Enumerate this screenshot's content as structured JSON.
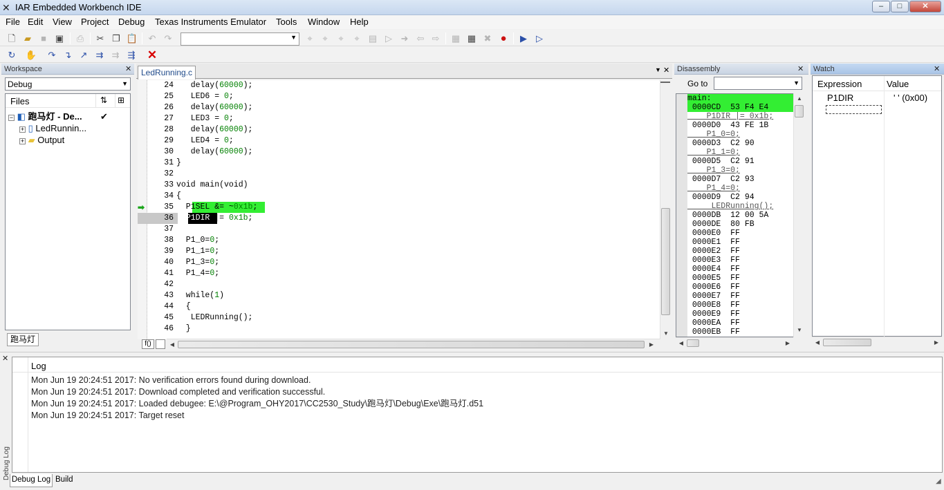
{
  "window": {
    "title": "IAR Embedded Workbench IDE",
    "minimize": "–",
    "maximize": "□",
    "close": "✕"
  },
  "menu": [
    "File",
    "Edit",
    "View",
    "Project",
    "Debug",
    "Texas Instruments Emulator",
    "Tools",
    "Window",
    "Help"
  ],
  "workspace": {
    "header": "Workspace",
    "config": "Debug",
    "files_label": "Files",
    "project": "跑马灯 - De...",
    "file1": "LedRunnin...",
    "folder": "Output",
    "bottom_tab": "跑马灯"
  },
  "editor": {
    "tab": "LedRunning.c",
    "lines": [
      {
        "n": "24",
        "t": "   delay(60000);"
      },
      {
        "n": "25",
        "t": "   LED6 = 0;"
      },
      {
        "n": "26",
        "t": "   delay(60000);"
      },
      {
        "n": "27",
        "t": "   LED3 = 0;"
      },
      {
        "n": "28",
        "t": "   delay(60000);"
      },
      {
        "n": "29",
        "t": "   LED4 = 0;"
      },
      {
        "n": "30",
        "t": "   delay(60000);"
      },
      {
        "n": "31",
        "t": "}"
      },
      {
        "n": "32",
        "t": ""
      },
      {
        "n": "33",
        "t": "void main(void)"
      },
      {
        "n": "34",
        "t": "{"
      },
      {
        "n": "35",
        "t": "  P1SEL &= ~0x1b;"
      },
      {
        "n": "36",
        "t": "  P1DIR |= 0x1b;"
      },
      {
        "n": "37",
        "t": ""
      },
      {
        "n": "38",
        "t": "  P1_0=0;"
      },
      {
        "n": "39",
        "t": "  P1_1=0;"
      },
      {
        "n": "40",
        "t": "  P1_3=0;"
      },
      {
        "n": "41",
        "t": "  P1_4=0;"
      },
      {
        "n": "42",
        "t": ""
      },
      {
        "n": "43",
        "t": "  while(1)"
      },
      {
        "n": "44",
        "t": "  {"
      },
      {
        "n": "45",
        "t": "   LEDRunning();"
      },
      {
        "n": "46",
        "t": "  }"
      }
    ],
    "current_line": "35",
    "cursor_line": "36",
    "fn_button": "f()"
  },
  "disassembly": {
    "header": "Disassembly",
    "goto_label": "Go to",
    "rows": [
      {
        "t": "main:",
        "type": "label"
      },
      {
        "t": " 0000CD  53 F4 E4",
        "type": "current"
      },
      {
        "t": "    P1DIR |= 0x1b;",
        "type": "src"
      },
      {
        "t": " 0000D0  43 FE 1B",
        "type": "code"
      },
      {
        "t": "    P1_0=0;",
        "type": "src"
      },
      {
        "t": " 0000D3  C2 90",
        "type": "code"
      },
      {
        "t": "    P1_1=0;",
        "type": "src"
      },
      {
        "t": " 0000D5  C2 91",
        "type": "code"
      },
      {
        "t": "    P1_3=0;",
        "type": "src"
      },
      {
        "t": " 0000D7  C2 93",
        "type": "code"
      },
      {
        "t": "    P1_4=0;",
        "type": "src"
      },
      {
        "t": " 0000D9  C2 94",
        "type": "code"
      },
      {
        "t": "     LEDRunning();",
        "type": "src"
      },
      {
        "t": " 0000DB  12 00 5A",
        "type": "code"
      },
      {
        "t": " 0000DE  80 FB",
        "type": "code"
      },
      {
        "t": " 0000E0  FF",
        "type": "code"
      },
      {
        "t": " 0000E1  FF",
        "type": "code"
      },
      {
        "t": " 0000E2  FF",
        "type": "code"
      },
      {
        "t": " 0000E3  FF",
        "type": "code"
      },
      {
        "t": " 0000E4  FF",
        "type": "code"
      },
      {
        "t": " 0000E5  FF",
        "type": "code"
      },
      {
        "t": " 0000E6  FF",
        "type": "code"
      },
      {
        "t": " 0000E7  FF",
        "type": "code"
      },
      {
        "t": " 0000E8  FF",
        "type": "code"
      },
      {
        "t": " 0000E9  FF",
        "type": "code"
      },
      {
        "t": " 0000EA  FF",
        "type": "code"
      },
      {
        "t": " 0000EB  FF",
        "type": "code"
      }
    ]
  },
  "watch": {
    "header": "Watch",
    "col_expr": "Expression",
    "col_value": "Value",
    "expr": "P1DIR",
    "value": "' ' (0x00)"
  },
  "log": {
    "header": "Log",
    "side_label": "Debug Log",
    "lines": [
      "Mon Jun 19 20:24:51 2017: No verification errors found during download.",
      "Mon Jun 19 20:24:51 2017: Download completed and verification successful.",
      "Mon Jun 19 20:24:51 2017: Loaded debugee: E:\\@Program_OHY2017\\CC2530_Study\\跑马灯\\Debug\\Exe\\跑马灯.d51",
      "Mon Jun 19 20:24:51 2017: Target reset"
    ],
    "tab1": "Debug Log",
    "tab2": "Build"
  },
  "colors": {
    "current_stmt": "#33ee33",
    "number": "#008000",
    "stop_red": "#d80000"
  }
}
